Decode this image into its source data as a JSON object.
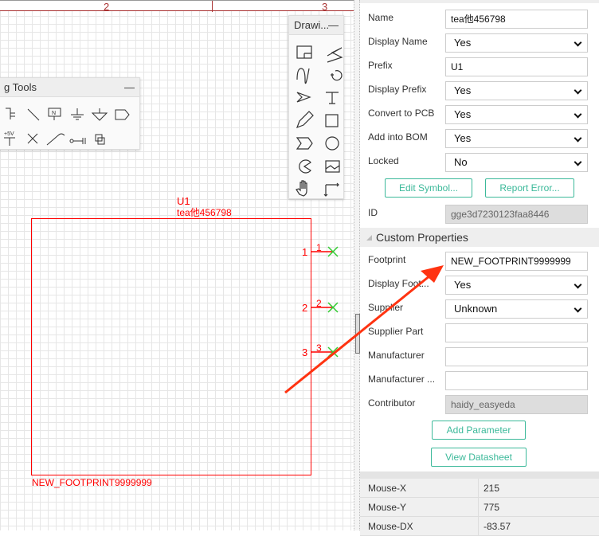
{
  "ruler": {
    "marks": [
      "2",
      "3"
    ]
  },
  "wiring_tools": {
    "title": "g Tools",
    "minimize": "—"
  },
  "drawing_tools": {
    "title": "Drawi...",
    "minimize": "—"
  },
  "symbol": {
    "prefix": "U1",
    "name": "tea他456798",
    "footprint": "NEW_FOOTPRINT9999999",
    "pins": [
      {
        "num": "1",
        "name": "1"
      },
      {
        "num": "2",
        "name": "2"
      },
      {
        "num": "3",
        "name": "3"
      }
    ],
    "color": "#ff0000",
    "pin_end_color": "#33cc33"
  },
  "props": {
    "name_label": "Name",
    "name_value": "tea他456798",
    "display_name_label": "Display Name",
    "display_name_value": "Yes",
    "prefix_label": "Prefix",
    "prefix_value": "U1",
    "display_prefix_label": "Display Prefix",
    "display_prefix_value": "Yes",
    "convert_label": "Convert to PCB",
    "convert_value": "Yes",
    "bom_label": "Add into BOM",
    "bom_value": "Yes",
    "locked_label": "Locked",
    "locked_value": "No",
    "edit_symbol": "Edit Symbol...",
    "report_error": "Report Error...",
    "id_label": "ID",
    "id_value": "gge3d7230123faa8446"
  },
  "custom": {
    "title": "Custom Properties",
    "footprint_label": "Footprint",
    "footprint_value": "NEW_FOOTPRINT9999999",
    "display_footprint_label": "Display Foot...",
    "display_footprint_value": "Yes",
    "supplier_label": "Supplier",
    "supplier_value": "Unknown",
    "supplier_part_label": "Supplier Part",
    "supplier_part_value": "",
    "manufacturer_label": "Manufacturer",
    "manufacturer_value": "",
    "manufacturer_part_label": "Manufacturer ...",
    "manufacturer_part_value": "",
    "contributor_label": "Contributor",
    "contributor_value": "haidy_easyeda",
    "add_parameter": "Add Parameter",
    "view_datasheet": "View Datasheet"
  },
  "mouse": [
    {
      "k": "Mouse-X",
      "v": "215"
    },
    {
      "k": "Mouse-Y",
      "v": "775"
    },
    {
      "k": "Mouse-DX",
      "v": "-83.57"
    }
  ],
  "accent": "#3cb99a"
}
